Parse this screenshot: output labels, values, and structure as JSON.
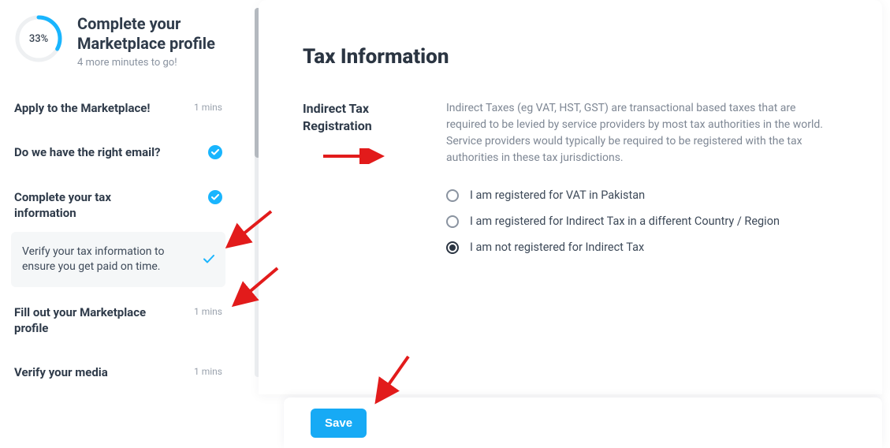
{
  "sidebar": {
    "progress_pct": "33%",
    "progress_value": 33,
    "title": "Complete your Marketplace profile",
    "subtitle": "4 more minutes to go!",
    "steps": [
      {
        "label": "Apply to the Marketplace!",
        "meta": "1 mins",
        "done": false
      },
      {
        "label": "Do we have the right email?",
        "meta": "",
        "done": true
      },
      {
        "label": "Complete your tax information",
        "meta": "",
        "done": true,
        "substep": {
          "text": "Verify your tax information to ensure you get paid on time.",
          "done": true
        }
      },
      {
        "label": "Fill out your Marketplace profile",
        "meta": "1 mins",
        "done": false
      },
      {
        "label": "Verify your media",
        "meta": "1 mins",
        "done": false
      }
    ]
  },
  "panel": {
    "title": "Tax Information",
    "field_label": "Indirect Tax Registration",
    "field_desc": "Indirect Taxes (eg VAT, HST, GST) are transactional based taxes that are required to be levied by service providers by most tax authorities in the world. Service providers would typically be required to be registered with the tax authorities in these tax jurisdictions.",
    "options": [
      {
        "label": "I am registered for VAT in Pakistan",
        "selected": false
      },
      {
        "label": "I am registered for Indirect Tax in a different Country / Region",
        "selected": false
      },
      {
        "label": "I am not registered for Indirect Tax",
        "selected": true
      }
    ]
  },
  "footer": {
    "save_label": "Save"
  },
  "colors": {
    "accent": "#19b5fe",
    "button": "#17aaf5",
    "arrow": "#e21b1b"
  }
}
